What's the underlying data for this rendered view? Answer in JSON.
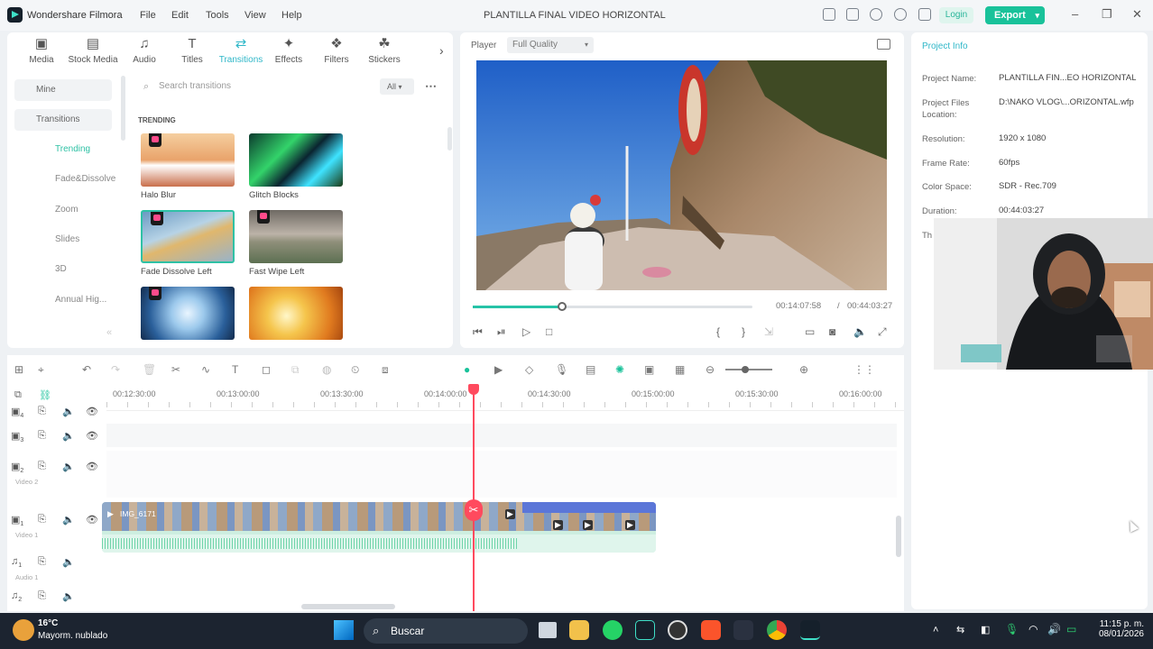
{
  "app": {
    "name": "Wondershare Filmora",
    "title": "PLANTILLA FINAL VIDEO HORIZONTAL"
  },
  "menu": [
    "File",
    "Edit",
    "Tools",
    "View",
    "Help"
  ],
  "titlebar": {
    "login": "Login",
    "export": "Export"
  },
  "media_tabs": [
    {
      "label": "Media",
      "icon": "media-icon"
    },
    {
      "label": "Stock Media",
      "icon": "stock-media-icon"
    },
    {
      "label": "Audio",
      "icon": "audio-icon"
    },
    {
      "label": "Titles",
      "icon": "titles-icon"
    },
    {
      "label": "Transitions",
      "icon": "transitions-icon",
      "active": true
    },
    {
      "label": "Effects",
      "icon": "effects-icon"
    },
    {
      "label": "Filters",
      "icon": "filters-icon"
    },
    {
      "label": "Stickers",
      "icon": "stickers-icon"
    }
  ],
  "sidebar": {
    "mine": "Mine",
    "transitions": "Transitions",
    "items": [
      "Trending",
      "Fade&Dissolve",
      "Zoom",
      "Slides",
      "3D",
      "Annual Hig..."
    ]
  },
  "search": {
    "placeholder": "Search transitions",
    "filter": "All"
  },
  "trending_label": "TRENDING",
  "transitions": [
    {
      "name": "Halo Blur"
    },
    {
      "name": "Glitch Blocks"
    },
    {
      "name": "Fade Dissolve Left"
    },
    {
      "name": "Fast Wipe Left"
    },
    {
      "name": ""
    },
    {
      "name": ""
    }
  ],
  "player": {
    "label": "Player",
    "quality": "Full Quality",
    "current": "00:14:07:58",
    "sep": "/",
    "total": "00:44:03:27",
    "progress": 0.32
  },
  "project_info": {
    "tab": "Project Info",
    "fields": [
      {
        "k": "Project Name:",
        "v": "PLANTILLA FIN...EO HORIZONTAL"
      },
      {
        "k": "Project Files Location:",
        "v": "D:\\NAKO VLOG\\...ORIZONTAL.wfp"
      },
      {
        "k": "Resolution:",
        "v": "1920 x 1080"
      },
      {
        "k": "Frame Rate:",
        "v": "60fps"
      },
      {
        "k": "Color Space:",
        "v": "SDR - Rec.709"
      },
      {
        "k": "Duration:",
        "v": "00:44:03:27"
      },
      {
        "k": "Th",
        "v": ""
      }
    ]
  },
  "ruler": [
    "00:12:30:00",
    "00:13:00:00",
    "00:13:30:00",
    "00:14:00:00",
    "00:14:30:00",
    "00:15:00:00",
    "00:15:30:00",
    "00:16:00:00"
  ],
  "tracks": [
    {
      "num": "4",
      "name": ""
    },
    {
      "num": "3",
      "name": ""
    },
    {
      "num": "2",
      "name": "Video 2"
    },
    {
      "num": "1",
      "name": "Video 1"
    },
    {
      "num": "1",
      "name": "Audio 1"
    },
    {
      "num": "2",
      "name": ""
    }
  ],
  "clip": {
    "name": "IMG_6171"
  },
  "taskbar": {
    "temp": "16°C",
    "weather": "Mayorm. nublado",
    "search": "Buscar",
    "time": "11:15 p. m.",
    "date": "08/01/2026"
  },
  "colors": {
    "accent": "#19c29a",
    "playhead": "#ff4a5e",
    "clip_blue": "#5b76d8",
    "audio_green": "#7fd9b8"
  }
}
